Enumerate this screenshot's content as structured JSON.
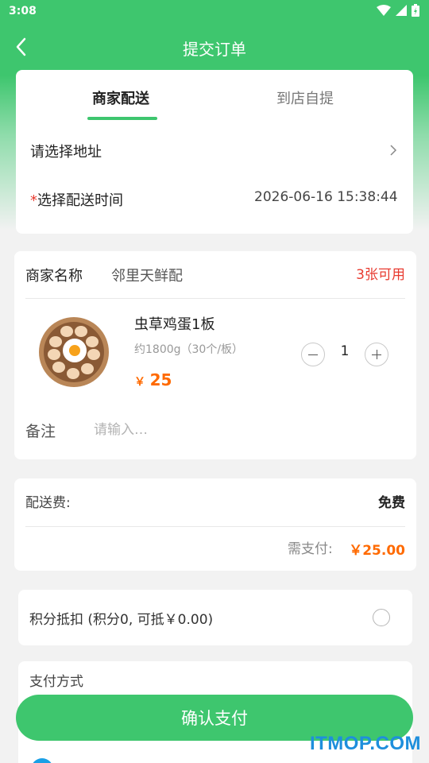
{
  "status_bar": {
    "time": "3:08"
  },
  "nav": {
    "title": "提交订单"
  },
  "delivery": {
    "tabs": [
      {
        "label": "商家配送",
        "active": true
      },
      {
        "label": "到店自提",
        "active": false
      }
    ],
    "address_prompt": "请选择地址",
    "time_required_mark": "*",
    "time_label": "选择配送时间",
    "time_value": "2026-06-16 15:38:44"
  },
  "merchant": {
    "name_label": "商家名称",
    "name_value": "邻里天鲜配",
    "coupon_text": "3张可用",
    "product": {
      "name": "虫草鸡蛋1板",
      "spec": "约1800g（30个/板）",
      "currency": "￥",
      "price": "25",
      "quantity": "1"
    },
    "remark_label": "备注",
    "remark_placeholder": "请输入…"
  },
  "fees": {
    "delivery_fee_label": "配送费:",
    "delivery_fee_value": "免费",
    "need_pay_label": "需支付:",
    "need_pay_value": "￥25.00"
  },
  "points": {
    "label": "积分抵扣 (积分0, 可抵￥0.00)",
    "checked": false
  },
  "payment": {
    "section_title": "支付方式"
  },
  "confirm_button": "确认支付",
  "watermark": "ITMOP.COM",
  "colors": {
    "primary": "#3ec66e",
    "price": "#ff6a00",
    "coupon": "#e83a2f"
  }
}
